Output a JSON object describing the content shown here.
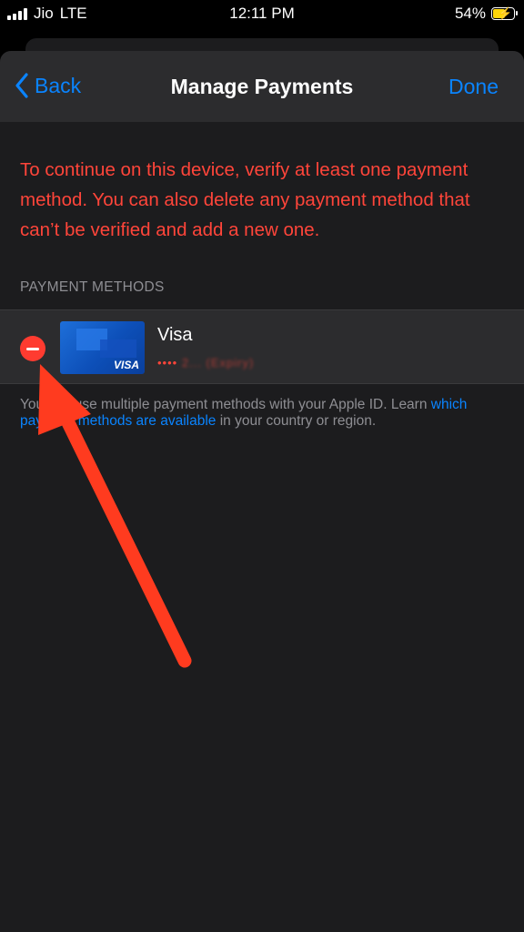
{
  "status_bar": {
    "carrier": "Jio",
    "network": "LTE",
    "time": "12:11 PM",
    "battery": "54%"
  },
  "nav": {
    "back_label": "Back",
    "title": "Manage Payments",
    "done_label": "Done"
  },
  "warning_text": "To continue on this device, verify at least one payment method. You can also delete any payment method that can’t be verified and add a new one.",
  "section_header": "PAYMENT METHODS",
  "payment_methods": [
    {
      "name": "Visa",
      "card_brand": "VISA",
      "number_dots": "••••",
      "number_masked": "2... (Expiry)"
    }
  ],
  "footer": {
    "prefix": "You can use multiple payment methods with your Apple ID. Learn ",
    "link": "which payment methods are available",
    "suffix": " in your country or region."
  },
  "colors": {
    "accent": "#0a84ff",
    "warning": "#ff453a",
    "annotation_arrow": "#ff3b1f"
  },
  "icons": [
    "chevron-left-icon",
    "minus-icon",
    "battery-icon",
    "signal-icon"
  ]
}
